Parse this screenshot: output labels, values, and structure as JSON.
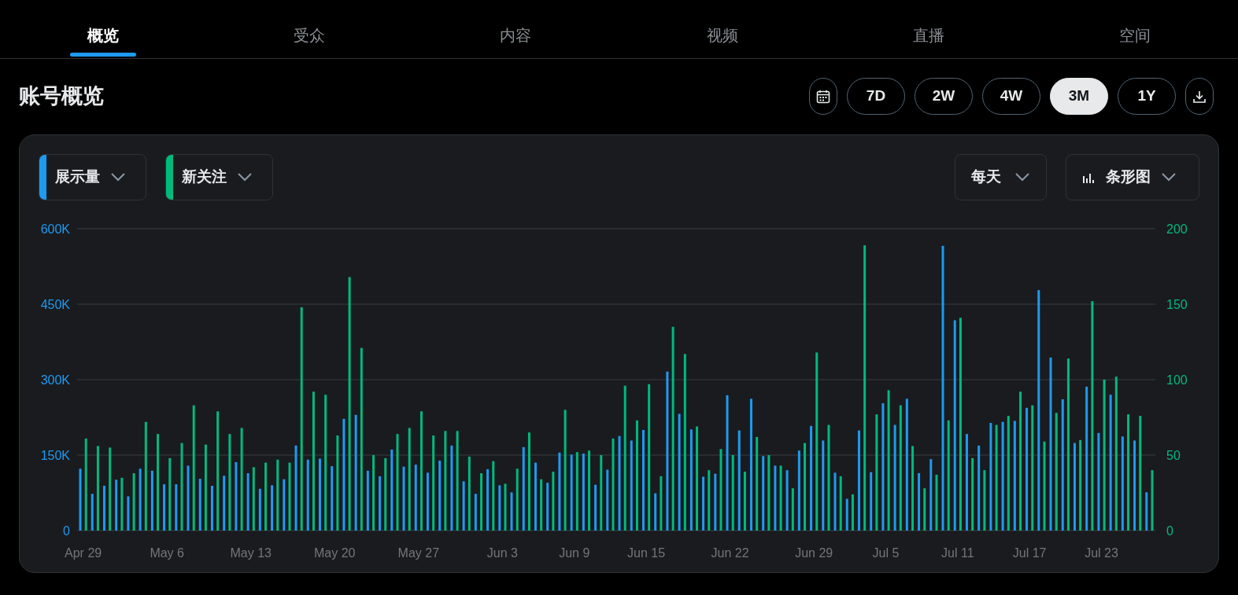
{
  "tabs": [
    {
      "label": "概览",
      "selected": true
    },
    {
      "label": "受众",
      "selected": false
    },
    {
      "label": "内容",
      "selected": false
    },
    {
      "label": "视频",
      "selected": false
    },
    {
      "label": "直播",
      "selected": false
    },
    {
      "label": "空间",
      "selected": false
    }
  ],
  "header": {
    "title": "账号概览",
    "range_buttons": [
      {
        "label": "7D",
        "selected": false
      },
      {
        "label": "2W",
        "selected": false
      },
      {
        "label": "4W",
        "selected": false
      },
      {
        "label": "3M",
        "selected": true
      },
      {
        "label": "1Y",
        "selected": false
      }
    ]
  },
  "panel": {
    "interval": "每天",
    "chart_kind": "条形图",
    "chart_data": {
      "type": "bar",
      "categories": [
        "Apr 29",
        null,
        null,
        null,
        null,
        null,
        null,
        "May 6",
        null,
        null,
        null,
        null,
        null,
        null,
        "May 13",
        null,
        null,
        null,
        null,
        null,
        null,
        "May 20",
        null,
        null,
        null,
        null,
        null,
        null,
        "May 27",
        null,
        null,
        null,
        null,
        null,
        null,
        "Jun 3",
        null,
        null,
        null,
        null,
        null,
        "Jun 9",
        null,
        null,
        null,
        null,
        null,
        "Jun 15",
        null,
        null,
        null,
        null,
        null,
        null,
        "Jun 22",
        null,
        null,
        null,
        null,
        null,
        null,
        "Jun 29",
        null,
        null,
        null,
        null,
        null,
        "Jul 5",
        null,
        null,
        null,
        null,
        null,
        "Jul 11",
        null,
        null,
        null,
        null,
        null,
        "Jul 17",
        null,
        null,
        null,
        null,
        null,
        "Jul 23",
        null,
        null,
        null,
        null
      ],
      "series": [
        {
          "name": "展示量",
          "color": "#1d9bf0",
          "values": [
            123000,
            73000,
            89000,
            101000,
            68000,
            123000,
            119000,
            92000,
            92000,
            129000,
            103000,
            89000,
            109000,
            136000,
            114000,
            83000,
            90000,
            102000,
            169000,
            141000,
            143000,
            128000,
            222000,
            230000,
            119000,
            108000,
            161000,
            127000,
            131000,
            115000,
            139000,
            169000,
            98000,
            73000,
            122000,
            90000,
            76000,
            166000,
            135000,
            95000,
            155000,
            151000,
            153000,
            91000,
            121000,
            188000,
            179000,
            200000,
            74000,
            316000,
            232000,
            201000,
            107000,
            113000,
            269000,
            199000,
            262000,
            148000,
            129000,
            120000,
            159000,
            208000,
            179000,
            115000,
            63000,
            199000,
            116000,
            253000,
            210000,
            262000,
            114000,
            142000,
            566000,
            418000,
            192000,
            169000,
            214000,
            216000,
            218000,
            244000,
            478000,
            344000,
            261000,
            174000,
            286000,
            194000,
            270000,
            187000,
            179000,
            76000
          ]
        },
        {
          "name": "新关注",
          "color": "#00ba7c",
          "axis": "y2",
          "values": [
            61,
            56,
            55,
            35,
            38,
            72,
            64,
            48,
            58,
            83,
            57,
            79,
            64,
            68,
            42,
            45,
            47,
            45,
            148,
            92,
            90,
            63,
            168,
            121,
            50,
            48,
            64,
            68,
            79,
            63,
            66,
            66,
            49,
            38,
            46,
            31,
            41,
            65,
            34,
            39,
            80,
            52,
            53,
            50,
            61,
            96,
            73,
            97,
            36,
            135,
            117,
            69,
            40,
            54,
            50,
            39,
            62,
            50,
            43,
            28,
            58,
            118,
            70,
            36,
            24,
            189,
            77,
            93,
            83,
            56,
            28,
            37,
            73,
            141,
            48,
            40,
            70,
            76,
            92,
            83,
            59,
            78,
            114,
            60,
            152,
            100,
            102,
            77,
            76,
            40
          ]
        }
      ],
      "ylim": [
        0,
        600000
      ],
      "yticks": [
        {
          "value": 0,
          "label": "0"
        },
        {
          "value": 150000,
          "label": "150K"
        },
        {
          "value": 300000,
          "label": "300K"
        },
        {
          "value": 450000,
          "label": "450K"
        },
        {
          "value": 600000,
          "label": "600K"
        }
      ],
      "y2lim": [
        0,
        200
      ],
      "y2ticks": [
        0,
        50,
        100,
        150,
        200
      ],
      "grid": true
    }
  }
}
